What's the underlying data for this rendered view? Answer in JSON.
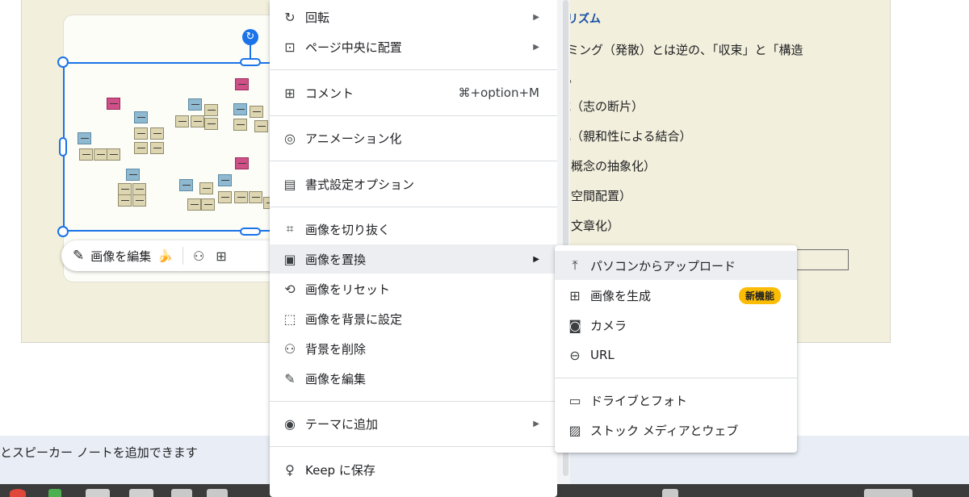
{
  "slide": {
    "heading": "リズム",
    "lines": [
      "ミング（発散）とは逆の、「収束」と「構造",
      "。",
      "成（志の断片）",
      "化（親和性による結合）",
      "（概念の抽象化）",
      "（空間配置）",
      "（文章化）"
    ]
  },
  "image_toolbar": {
    "edit_label": "画像を編集",
    "edit_emoji": "🍌"
  },
  "context_menu": {
    "items": [
      {
        "icon": "rotate-icon",
        "label": "回転",
        "arrow": "▶"
      },
      {
        "icon": "center-page-icon",
        "label": "ページ中央に配置",
        "arrow": "▶"
      },
      {
        "icon": "comment-icon",
        "label": "コメント",
        "shortcut": "⌘+option+M"
      },
      {
        "icon": "animation-icon",
        "label": "アニメーション化"
      },
      {
        "icon": "format-paint-icon",
        "label": "書式設定オプション"
      },
      {
        "icon": "crop-icon",
        "label": "画像を切り抜く"
      },
      {
        "icon": "replace-image-icon",
        "label": "画像を置換",
        "arrow": "▶"
      },
      {
        "icon": "reset-image-icon",
        "label": "画像をリセット"
      },
      {
        "icon": "set-background-icon",
        "label": "画像を背景に設定"
      },
      {
        "icon": "remove-background-icon",
        "label": "背景を削除"
      },
      {
        "icon": "edit-image-icon",
        "label": "画像を編集"
      },
      {
        "icon": "palette-icon",
        "label": "テーマに追加",
        "arrow": "▶"
      },
      {
        "icon": "keep-bulb-icon",
        "label": "Keep に保存"
      }
    ]
  },
  "submenu": {
    "items": [
      {
        "icon": "upload-icon",
        "label": "パソコンからアップロード"
      },
      {
        "icon": "generate-image-icon",
        "label": "画像を生成",
        "badge": "新機能"
      },
      {
        "icon": "camera-icon",
        "label": "カメラ"
      },
      {
        "icon": "link-icon",
        "label": "URL"
      },
      {
        "icon": "folder-icon",
        "label": "ドライブとフォト"
      },
      {
        "icon": "stock-media-icon",
        "label": "ストック メディアとウェブ"
      }
    ]
  },
  "speaker_notes": {
    "text": "とスピーカー ノートを追加できます"
  },
  "colors": {
    "accent": "#1a73e8",
    "slide_bg": "#f2efdc",
    "badge": "#fbbc04",
    "heading": "#174ea6"
  }
}
